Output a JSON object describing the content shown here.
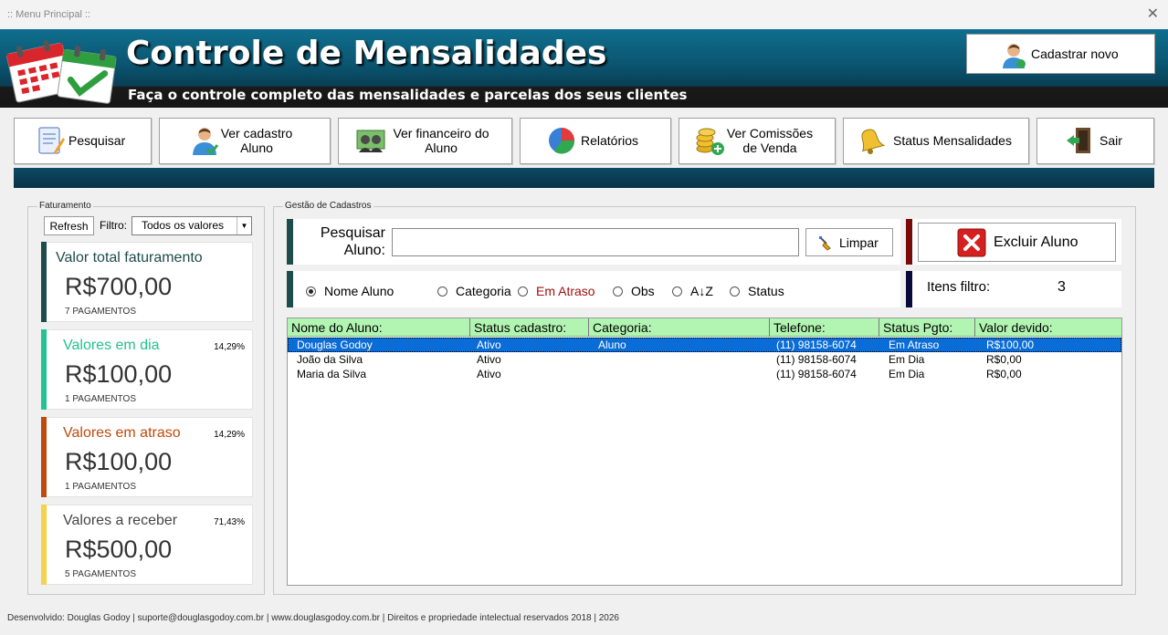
{
  "window": {
    "title": ":: Menu Principal ::",
    "close": "✕"
  },
  "header": {
    "title": "Controle de Mensalidades",
    "subtitle": "Faça o controle completo das mensalidades e parcelas dos seus clientes",
    "new_button": "Cadastrar novo"
  },
  "nav": [
    {
      "label": "Pesquisar",
      "icon": "notepad-search-icon"
    },
    {
      "label": "Ver cadastro Aluno",
      "icon": "user-icon"
    },
    {
      "label": "Ver financeiro do Aluno",
      "icon": "money-people-icon"
    },
    {
      "label": "Relatórios",
      "icon": "pie-chart-icon"
    },
    {
      "label": "Ver Comissões de Venda",
      "icon": "coins-add-icon"
    },
    {
      "label": "Status Mensalidades",
      "icon": "bell-icon"
    },
    {
      "label": "Sair",
      "icon": "exit-door-icon"
    }
  ],
  "faturamento": {
    "group_title": "Faturamento",
    "refresh": "Refresh",
    "filter_label": "Filtro:",
    "filter_value": "Todos os valores",
    "cards": [
      {
        "title": "Valor total faturamento",
        "percent": "",
        "value": "R$700,00",
        "count": "7 PAGAMENTOS",
        "color": "#1e4b4b"
      },
      {
        "title": "Valores em dia",
        "percent": "14,29%",
        "value": "R$100,00",
        "count": "1 PAGAMENTOS",
        "color": "#22c38e"
      },
      {
        "title": "Valores em atraso",
        "percent": "14,29%",
        "value": "R$100,00",
        "count": "1 PAGAMENTOS",
        "color": "#c0490f"
      },
      {
        "title": "Valores a receber",
        "percent": "71,43%",
        "value": "R$500,00",
        "count": "5 PAGAMENTOS",
        "color": "#f5d24a"
      }
    ]
  },
  "gestao": {
    "group_title": "Gestão de Cadastros",
    "search_label": "Pesquisar Aluno:",
    "search_value": "",
    "clear_button": "Limpar",
    "delete_button": "Excluir Aluno",
    "radios": [
      {
        "label": "Nome Aluno",
        "checked": true
      },
      {
        "label": "Categoria",
        "checked": false
      },
      {
        "label": "Em Atraso",
        "checked": false
      },
      {
        "label": "Obs",
        "checked": false
      },
      {
        "label": "A↓Z",
        "checked": false
      },
      {
        "label": "Status",
        "checked": false
      }
    ],
    "itens_label": "Itens filtro:",
    "itens_value": "3",
    "columns": [
      "Nome do Aluno:",
      "Status cadastro:",
      "Categoria:",
      "Telefone:",
      "Status Pgto:",
      "Valor devido:"
    ],
    "rows": [
      [
        "Douglas Godoy",
        "Ativo",
        "Aluno",
        "(11) 98158-6074",
        "Em Atraso",
        "R$100,00"
      ],
      [
        "João da Silva",
        "Ativo",
        "",
        "(11) 98158-6074",
        "Em Dia",
        "R$0,00"
      ],
      [
        "Maria da Silva",
        "Ativo",
        "",
        "(11) 98158-6074",
        "Em Dia",
        "R$0,00"
      ]
    ]
  },
  "footer": "Desenvolvido: Douglas Godoy | suporte@douglasgodoy.com.br | www.douglasgodoy.com.br | Direitos e propriedade intelectual reservados 2018 | 2026"
}
